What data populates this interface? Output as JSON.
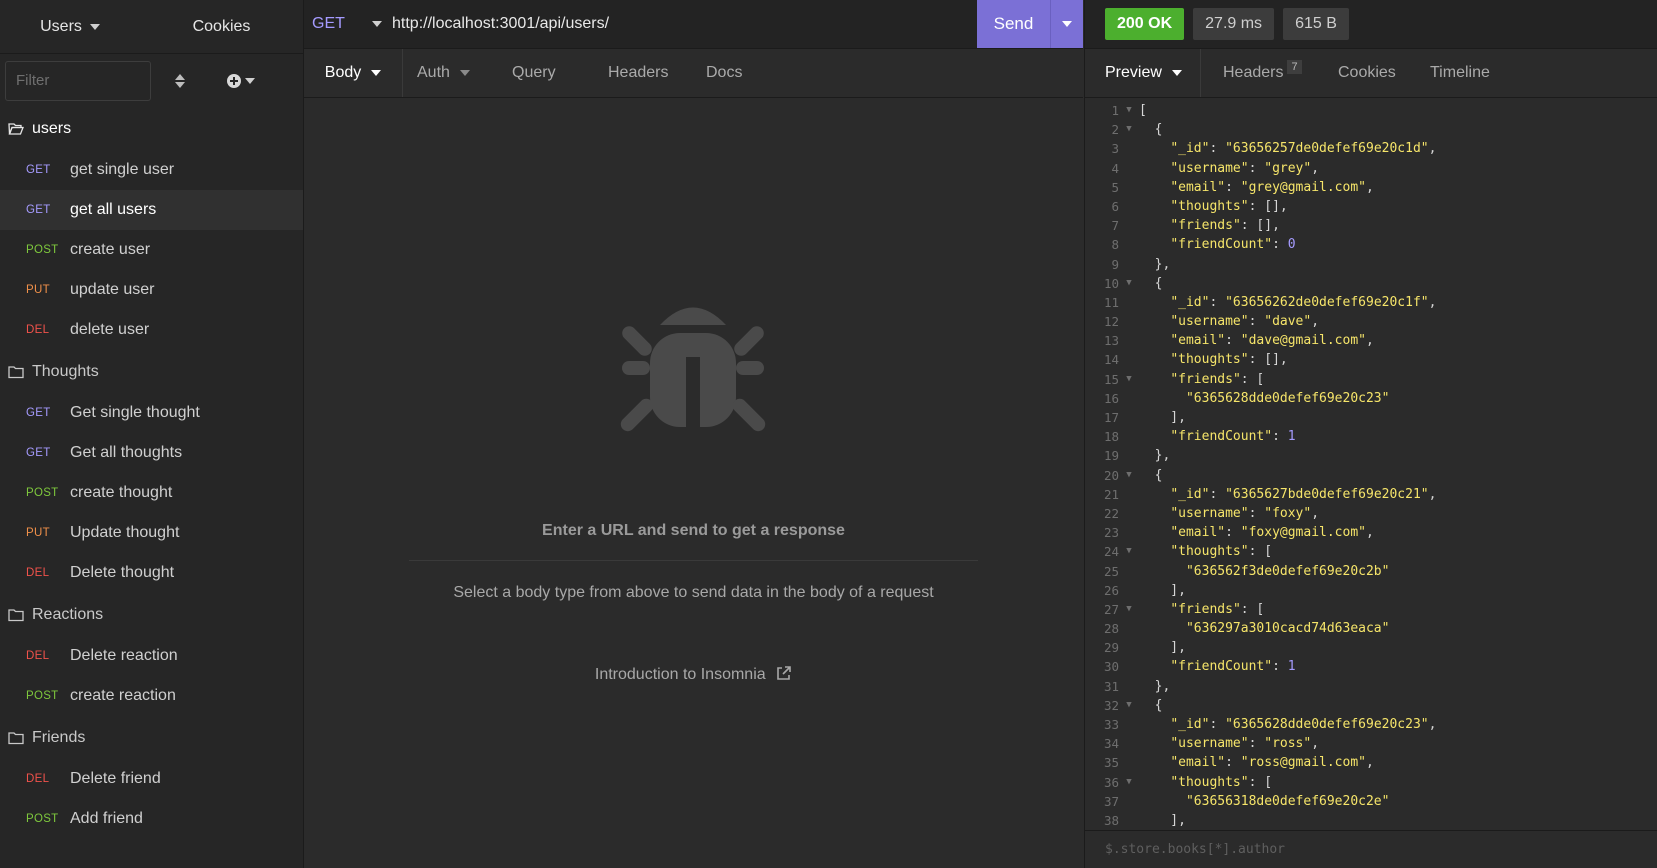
{
  "sidebar": {
    "workspace_label": "Users",
    "cookies_label": "Cookies",
    "filter_placeholder": "Filter",
    "folders": [
      {
        "name": "users",
        "open": true,
        "requests": [
          {
            "method": "GET",
            "name": "get single user"
          },
          {
            "method": "GET",
            "name": "get all users",
            "active": true
          },
          {
            "method": "POST",
            "name": "create user"
          },
          {
            "method": "PUT",
            "name": "update user"
          },
          {
            "method": "DEL",
            "name": "delete user"
          }
        ]
      },
      {
        "name": "Thoughts",
        "requests": [
          {
            "method": "GET",
            "name": "Get single thought"
          },
          {
            "method": "GET",
            "name": "Get all thoughts"
          },
          {
            "method": "POST",
            "name": "create thought"
          },
          {
            "method": "PUT",
            "name": "Update thought"
          },
          {
            "method": "DEL",
            "name": "Delete thought"
          }
        ]
      },
      {
        "name": "Reactions",
        "requests": [
          {
            "method": "DEL",
            "name": "Delete reaction"
          },
          {
            "method": "POST",
            "name": "create reaction"
          }
        ]
      },
      {
        "name": "Friends",
        "requests": [
          {
            "method": "DEL",
            "name": "Delete friend"
          },
          {
            "method": "POST",
            "name": "Add friend"
          }
        ]
      }
    ]
  },
  "request": {
    "method": "GET",
    "url": "http://localhost:3001/api/users/",
    "send_label": "Send",
    "tabs": {
      "body": "Body",
      "auth": "Auth",
      "query": "Query",
      "headers": "Headers",
      "docs": "Docs"
    },
    "empty_title": "Enter a URL and send to get a response",
    "empty_hint": "Select a body type from above to send data in the body of a request",
    "intro_link": "Introduction to Insomnia"
  },
  "response": {
    "status": "200 OK",
    "time": "27.9 ms",
    "size": "615 B",
    "tabs": {
      "preview": "Preview",
      "headers": "Headers",
      "headers_count": "7",
      "cookies": "Cookies",
      "timeline": "Timeline"
    },
    "filter_placeholder": "$.store.books[*].author",
    "lines": [
      {
        "n": "1",
        "fold": true,
        "text": "["
      },
      {
        "n": "2",
        "fold": true,
        "text": "  {"
      },
      {
        "n": "3",
        "key": "_id",
        "value": "\"63656257de0defef69e20c1d\"",
        "type": "s",
        "indent": "    ",
        "comma": ","
      },
      {
        "n": "4",
        "key": "username",
        "value": "\"grey\"",
        "type": "s",
        "indent": "    ",
        "comma": ","
      },
      {
        "n": "5",
        "key": "email",
        "value": "\"grey@gmail.com\"",
        "type": "s",
        "indent": "    ",
        "comma": ","
      },
      {
        "n": "6",
        "key": "thoughts",
        "value": "[]",
        "type": "p",
        "indent": "    ",
        "comma": ","
      },
      {
        "n": "7",
        "key": "friends",
        "value": "[]",
        "type": "p",
        "indent": "    ",
        "comma": ","
      },
      {
        "n": "8",
        "key": "friendCount",
        "value": "0",
        "type": "n",
        "indent": "    ",
        "comma": ""
      },
      {
        "n": "9",
        "text": "  },"
      },
      {
        "n": "10",
        "fold": true,
        "text": "  {"
      },
      {
        "n": "11",
        "key": "_id",
        "value": "\"63656262de0defef69e20c1f\"",
        "type": "s",
        "indent": "    ",
        "comma": ","
      },
      {
        "n": "12",
        "key": "username",
        "value": "\"dave\"",
        "type": "s",
        "indent": "    ",
        "comma": ","
      },
      {
        "n": "13",
        "key": "email",
        "value": "\"dave@gmail.com\"",
        "type": "s",
        "indent": "    ",
        "comma": ","
      },
      {
        "n": "14",
        "key": "thoughts",
        "value": "[]",
        "type": "p",
        "indent": "    ",
        "comma": ","
      },
      {
        "n": "15",
        "fold": true,
        "key": "friends",
        "value": "[",
        "type": "p",
        "indent": "    ",
        "comma": ""
      },
      {
        "n": "16",
        "str": "\"6365628dde0defef69e20c23\"",
        "indent": "      "
      },
      {
        "n": "17",
        "text": "    ],"
      },
      {
        "n": "18",
        "key": "friendCount",
        "value": "1",
        "type": "n",
        "indent": "    ",
        "comma": ""
      },
      {
        "n": "19",
        "text": "  },"
      },
      {
        "n": "20",
        "fold": true,
        "text": "  {"
      },
      {
        "n": "21",
        "key": "_id",
        "value": "\"6365627bde0defef69e20c21\"",
        "type": "s",
        "indent": "    ",
        "comma": ","
      },
      {
        "n": "22",
        "key": "username",
        "value": "\"foxy\"",
        "type": "s",
        "indent": "    ",
        "comma": ","
      },
      {
        "n": "23",
        "key": "email",
        "value": "\"foxy@gmail.com\"",
        "type": "s",
        "indent": "    ",
        "comma": ","
      },
      {
        "n": "24",
        "fold": true,
        "key": "thoughts",
        "value": "[",
        "type": "p",
        "indent": "    ",
        "comma": ""
      },
      {
        "n": "25",
        "str": "\"636562f3de0defef69e20c2b\"",
        "indent": "      "
      },
      {
        "n": "26",
        "text": "    ],"
      },
      {
        "n": "27",
        "fold": true,
        "key": "friends",
        "value": "[",
        "type": "p",
        "indent": "    ",
        "comma": ""
      },
      {
        "n": "28",
        "str": "\"636297a3010cacd74d63eaca\"",
        "indent": "      "
      },
      {
        "n": "29",
        "text": "    ],"
      },
      {
        "n": "30",
        "key": "friendCount",
        "value": "1",
        "type": "n",
        "indent": "    ",
        "comma": ""
      },
      {
        "n": "31",
        "text": "  },"
      },
      {
        "n": "32",
        "fold": true,
        "text": "  {"
      },
      {
        "n": "33",
        "key": "_id",
        "value": "\"6365628dde0defef69e20c23\"",
        "type": "s",
        "indent": "    ",
        "comma": ","
      },
      {
        "n": "34",
        "key": "username",
        "value": "\"ross\"",
        "type": "s",
        "indent": "    ",
        "comma": ","
      },
      {
        "n": "35",
        "key": "email",
        "value": "\"ross@gmail.com\"",
        "type": "s",
        "indent": "    ",
        "comma": ","
      },
      {
        "n": "36",
        "fold": true,
        "key": "thoughts",
        "value": "[",
        "type": "p",
        "indent": "    ",
        "comma": ""
      },
      {
        "n": "37",
        "str": "\"63656318de0defef69e20c2e\"",
        "indent": "      "
      },
      {
        "n": "38",
        "text": "    ],"
      }
    ]
  },
  "colors": {
    "accent": "#7b70d6",
    "status_ok": "#4caf2e",
    "method_get": "#a59bff",
    "method_post": "#7ec83d",
    "method_put": "#f0904a",
    "method_del": "#f0524b",
    "json_string": "#f6e56a",
    "json_number": "#a59bff"
  },
  "icons": [
    "folder-open-icon",
    "folder-icon",
    "sort-icon",
    "plus-circle-icon",
    "bug-icon",
    "external-link-icon",
    "chevron-down-icon"
  ]
}
